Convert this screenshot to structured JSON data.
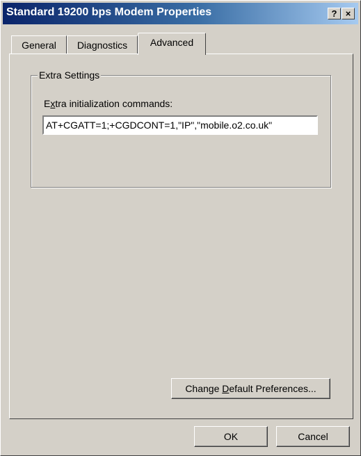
{
  "window": {
    "title": "Standard 19200 bps Modem Properties",
    "help_button": "?",
    "close_button": "×"
  },
  "tabs": [
    {
      "label": "General"
    },
    {
      "label": "Diagnostics"
    },
    {
      "label": "Advanced",
      "selected": true
    }
  ],
  "extra_settings": {
    "group_label": "Extra Settings",
    "init_label_prefix": "E",
    "init_label_underlined": "x",
    "init_label_rest": "tra initialization commands:",
    "init_value": "AT+CGATT=1;+CGDCONT=1,\"IP\",\"mobile.o2.co.uk\""
  },
  "buttons": {
    "change_prefix": "Change ",
    "change_underlined": "D",
    "change_rest": "efault Preferences...",
    "ok": "OK",
    "cancel": "Cancel"
  },
  "colors": {
    "title_active_start": "#0a246a",
    "title_active_end": "#a6caf0",
    "face": "#d4d0c8"
  }
}
